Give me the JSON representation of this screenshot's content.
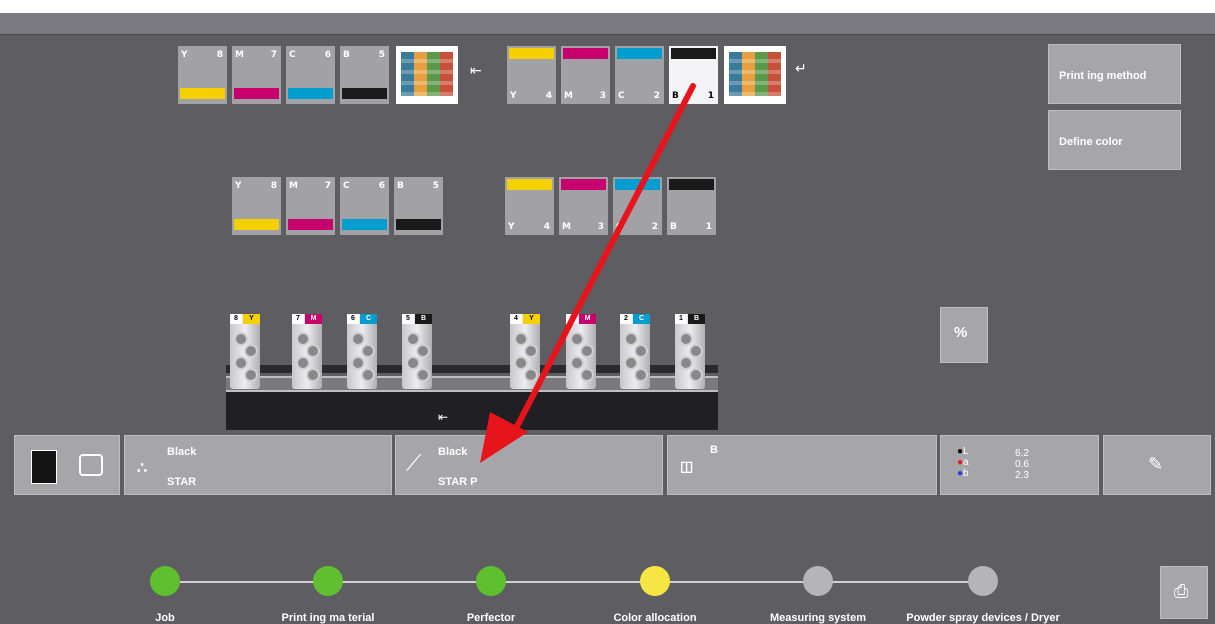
{
  "top_row": {
    "left_units": [
      {
        "letter": "Y",
        "num": "8",
        "color": "#f5d000"
      },
      {
        "letter": "M",
        "num": "7",
        "color": "#c8006e"
      },
      {
        "letter": "C",
        "num": "6",
        "color": "#009ecf"
      },
      {
        "letter": "B",
        "num": "5",
        "color": "#1a1a1a"
      }
    ],
    "right_units": [
      {
        "letter": "Y",
        "num": "4",
        "color": "#f5d000"
      },
      {
        "letter": "M",
        "num": "3",
        "color": "#c8006e"
      },
      {
        "letter": "C",
        "num": "2",
        "color": "#009ecf"
      },
      {
        "letter": "B",
        "num": "1",
        "color": "#1a1a1a"
      }
    ]
  },
  "side_buttons": {
    "printing_method": "Print ing method",
    "define_color": "Define color"
  },
  "info_bar": {
    "dot_title": "Black",
    "dot_sub": "STAR",
    "curve_title": "Black",
    "curve_sub": "STAR P",
    "ink_label": "B",
    "lab_l_label": "L",
    "lab_a_label": "a",
    "lab_b_label": "b",
    "lab_l_value": "6.2",
    "lab_a_value": "0.6",
    "lab_b_value": "2.3"
  },
  "steps": [
    {
      "label": "Job",
      "color": "#5fbf2f"
    },
    {
      "label": "Print ing ma terial",
      "color": "#5fbf2f"
    },
    {
      "label": "Perfector",
      "color": "#5fbf2f"
    },
    {
      "label": "Color allocation",
      "color": "#f5e642"
    },
    {
      "label": "Measuring system",
      "color": "#b5b5b8"
    },
    {
      "label": "Powder spray devices / Dryer",
      "color": "#b5b5b8"
    }
  ],
  "colors": {
    "accent_arrow": "#e8141c",
    "background": "#5d5d62"
  }
}
